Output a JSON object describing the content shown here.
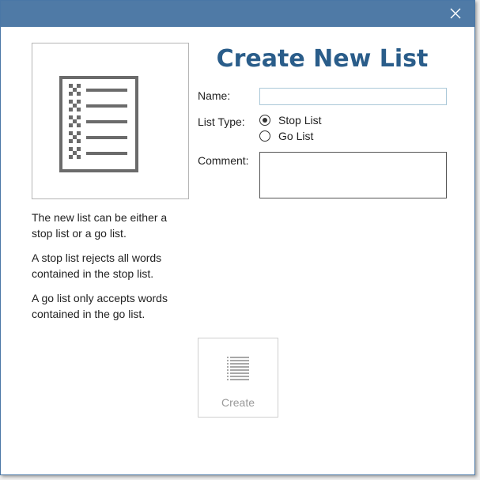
{
  "dialog": {
    "title": "Create New List",
    "close_icon": "close-icon"
  },
  "form": {
    "name_label": "Name:",
    "name_value": "",
    "list_type_label": "List Type:",
    "options": [
      {
        "label": "Stop List",
        "selected": true
      },
      {
        "label": "Go List",
        "selected": false
      }
    ],
    "comment_label": "Comment:",
    "comment_value": ""
  },
  "description": {
    "p1": "The new list can be either a stop list or a go list.",
    "p2": "A stop list rejects all words contained in the stop list.",
    "p3": "A go list only accepts words contained in the go list."
  },
  "actions": {
    "create_label": "Create",
    "create_enabled": false,
    "create_icon": "list-icon"
  },
  "colors": {
    "titlebar": "#4f7aa6",
    "title_text": "#2a5d8a",
    "disabled_text": "#9a9a9a"
  }
}
